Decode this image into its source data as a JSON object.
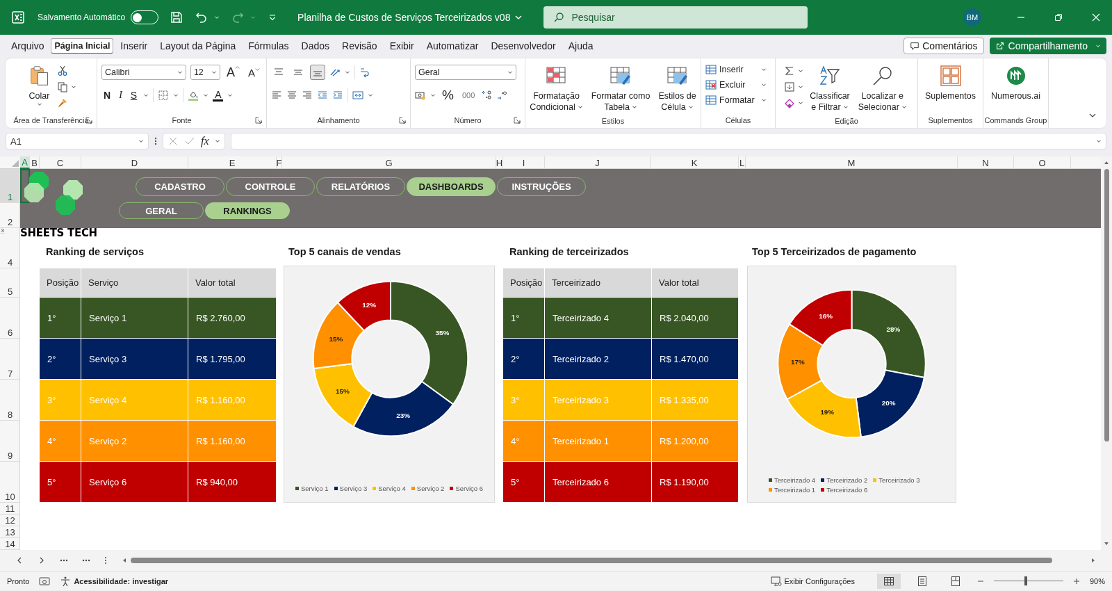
{
  "title_bar": {
    "autosave_label": "Salvamento Automático",
    "autosave_on": false,
    "document_title": "Planilha de Custos de Serviços Terceirizados v08",
    "search_placeholder": "Pesquisar",
    "user_initials": "BM"
  },
  "menu_tabs": [
    {
      "label": "Arquivo",
      "selected": false
    },
    {
      "label": "Página Inicial",
      "selected": true
    },
    {
      "label": "Inserir",
      "selected": false
    },
    {
      "label": "Layout da Página",
      "selected": false
    },
    {
      "label": "Fórmulas",
      "selected": false
    },
    {
      "label": "Dados",
      "selected": false
    },
    {
      "label": "Revisão",
      "selected": false
    },
    {
      "label": "Exibir",
      "selected": false
    },
    {
      "label": "Automatizar",
      "selected": false
    },
    {
      "label": "Desenvolvedor",
      "selected": false
    },
    {
      "label": "Ajuda",
      "selected": false
    }
  ],
  "comments_button": "Comentários",
  "share_button": "Compartilhamento",
  "ribbon": {
    "clipboard": {
      "paste_label": "Colar",
      "group_label": "Área de Transferência"
    },
    "font": {
      "font_name": "Calibri",
      "font_size": "12",
      "grow_glyph": "A",
      "shrink_glyph": "A",
      "bold_glyph": "N",
      "italic_glyph": "I",
      "underline_glyph": "S",
      "font_color_glyph": "A",
      "group_label": "Fonte"
    },
    "alignment": {
      "vertical": [
        {
          "kind": "top",
          "selected": false
        },
        {
          "kind": "middle",
          "selected": false
        },
        {
          "kind": "bottom",
          "selected": true
        }
      ],
      "group_label": "Alinhamento"
    },
    "number": {
      "format": "Geral",
      "percent_glyph": "%",
      "thousands_glyph": "000",
      "group_label": "Número"
    },
    "styles": {
      "buttons": [
        {
          "lines": [
            "Formatação",
            "Condicional"
          ]
        },
        {
          "lines": [
            "Formatar como",
            "Tabela"
          ]
        },
        {
          "lines": [
            "Estilos de",
            "Célula"
          ]
        }
      ],
      "group_label": "Estilos"
    },
    "cells": {
      "buttons": [
        "Inserir",
        "Excluir",
        "Formatar"
      ],
      "group_label": "Células"
    },
    "editing": {
      "buttons": [
        {
          "lines": [
            "Classificar",
            "e Filtrar"
          ]
        },
        {
          "lines": [
            "Localizar e",
            "Selecionar"
          ]
        }
      ],
      "group_label": "Edição"
    },
    "addins": {
      "button": "Suplementos",
      "group_label": "Suplementos"
    },
    "commands": {
      "button": "Numerous.ai",
      "group_label": "Commands Group"
    }
  },
  "formula_bar": {
    "name_box": "A1",
    "fx_label": "fx"
  },
  "sheet": {
    "columns": [
      {
        "label": "A",
        "selected": true
      },
      {
        "label": "B",
        "selected": false
      },
      {
        "label": "C",
        "selected": false
      },
      {
        "label": "D",
        "selected": false
      },
      {
        "label": "E",
        "selected": false
      },
      {
        "label": "F",
        "selected": false
      },
      {
        "label": "G",
        "selected": false
      },
      {
        "label": "H",
        "selected": false
      },
      {
        "label": "I",
        "selected": false
      },
      {
        "label": "J",
        "selected": false
      },
      {
        "label": "K",
        "selected": false
      },
      {
        "label": "L",
        "selected": false
      },
      {
        "label": "M",
        "selected": false
      },
      {
        "label": "N",
        "selected": false
      },
      {
        "label": "O",
        "selected": false
      }
    ],
    "rows": [
      {
        "label": "1",
        "selected": true
      },
      {
        "label": "2",
        "selected": false
      },
      {
        "label": "3",
        "selected": false
      },
      {
        "label": "4",
        "selected": false
      },
      {
        "label": "5",
        "selected": false
      },
      {
        "label": "6",
        "selected": false
      },
      {
        "label": "7",
        "selected": false
      },
      {
        "label": "8",
        "selected": false
      },
      {
        "label": "9",
        "selected": false
      },
      {
        "label": "10",
        "selected": false
      },
      {
        "label": "11",
        "selected": false
      },
      {
        "label": "12",
        "selected": false
      },
      {
        "label": "13",
        "selected": false
      },
      {
        "label": "14",
        "selected": false
      }
    ]
  },
  "banner": {
    "logo_text": "SHEETS TECH",
    "nav_buttons": [
      {
        "label": "CADASTRO",
        "selected": false
      },
      {
        "label": "CONTROLE",
        "selected": false
      },
      {
        "label": "RELATÓRIOS",
        "selected": false
      },
      {
        "label": "DASHBOARDS",
        "selected": true
      },
      {
        "label": "INSTRUÇÕES",
        "selected": false
      }
    ],
    "sub_buttons": [
      {
        "label": "GERAL",
        "selected": false
      },
      {
        "label": "RANKINGS",
        "selected": true
      }
    ]
  },
  "dashboard": {
    "panels": [
      {
        "kind": "table",
        "title": "Ranking de serviços",
        "columns": [
          "Posição",
          "Serviço",
          "Valor total"
        ],
        "rows": [
          {
            "cells": [
              "1°",
              "Serviço 1",
              "R$ 2.760,00"
            ],
            "color": "#375623"
          },
          {
            "cells": [
              "2°",
              "Serviço 3",
              "R$ 1.795,00"
            ],
            "color": "#002060"
          },
          {
            "cells": [
              "3°",
              "Serviço 4",
              "R$ 1.160,00"
            ],
            "color": "#ffc000"
          },
          {
            "cells": [
              "4°",
              "Serviço 2",
              "R$ 1.160,00"
            ],
            "color": "#ff9000"
          },
          {
            "cells": [
              "5°",
              "Serviço 6",
              "R$ 940,00"
            ],
            "color": "#c00000"
          }
        ]
      },
      {
        "kind": "chart",
        "title": "Top 5 canais de vendas",
        "chart_data": {
          "type": "donut",
          "categories": [
            "Serviço 1",
            "Serviço 3",
            "Serviço 4",
            "Serviço 2",
            "Serviço 6"
          ],
          "values": [
            35,
            23,
            15,
            15,
            12
          ],
          "colors": [
            "#375623",
            "#002060",
            "#ffc000",
            "#ff9000",
            "#c00000"
          ],
          "value_labels": [
            "35%",
            "23%",
            "15%",
            "15%",
            "12%"
          ],
          "legend": "bottom"
        }
      },
      {
        "kind": "table",
        "title": "Ranking de terceirizados",
        "columns": [
          "Posição",
          "Terceirizado",
          "Valor total"
        ],
        "rows": [
          {
            "cells": [
              "1°",
              "Terceirizado 4",
              "R$ 2.040,00"
            ],
            "color": "#375623"
          },
          {
            "cells": [
              "2°",
              "Terceirizado 2",
              "R$ 1.470,00"
            ],
            "color": "#002060"
          },
          {
            "cells": [
              "3°",
              "Terceirizado 3",
              "R$ 1.335,00"
            ],
            "color": "#ffc000"
          },
          {
            "cells": [
              "4°",
              "Terceirizado 1",
              "R$ 1.200,00"
            ],
            "color": "#ff9000"
          },
          {
            "cells": [
              "5°",
              "Terceirizado 6",
              "R$ 1.190,00"
            ],
            "color": "#c00000"
          }
        ]
      },
      {
        "kind": "chart",
        "title": "Top 5 Terceirizados de pagamento",
        "chart_data": {
          "type": "donut",
          "categories": [
            "Terceirizado 4",
            "Terceirizado 2",
            "Terceirizado 3",
            "Terceirizado 1",
            "Terceirizado 6"
          ],
          "values": [
            28,
            20,
            19,
            17,
            16
          ],
          "colors": [
            "#375623",
            "#002060",
            "#ffc000",
            "#ff9000",
            "#c00000"
          ],
          "value_labels": [
            "28%",
            "20%",
            "19%",
            "17%",
            "16%"
          ],
          "legend": "bottom"
        }
      }
    ]
  },
  "status_bar": {
    "ready": "Pronto",
    "accessibility": "Acessibilidade: investigar",
    "display_settings": "Exibir Configurações",
    "views": [
      {
        "kind": "normal",
        "selected": true
      },
      {
        "kind": "page_layout",
        "selected": false
      },
      {
        "kind": "page_break",
        "selected": false
      }
    ],
    "zoom_slider": {
      "level": 0.46
    },
    "zoom_label": "90%"
  }
}
